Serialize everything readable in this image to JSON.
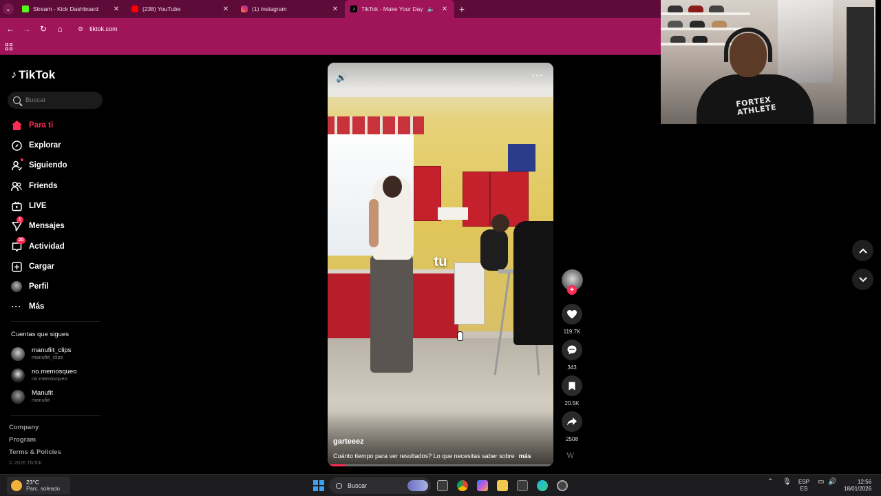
{
  "browser": {
    "tabs": [
      {
        "title": "Stream - Kick Dashboard",
        "favicon_color": "#53fc18"
      },
      {
        "title": "(238) YouTube",
        "favicon_color": "#ff0000"
      },
      {
        "title": "(1) Instagram",
        "favicon_color": "#e1306c"
      },
      {
        "title": "TikTok - Make Your Day",
        "favicon_color": "#000000"
      }
    ],
    "new_tab": "+",
    "url": "tiktok.com",
    "theme_color": "#a0145a"
  },
  "tiktok": {
    "logo": "TikTok",
    "search_placeholder": "Buscar",
    "nav": [
      {
        "label": "Para ti",
        "icon": "home-icon",
        "active": true
      },
      {
        "label": "Explorar",
        "icon": "compass-icon"
      },
      {
        "label": "Siguiendo",
        "icon": "following-icon"
      },
      {
        "label": "Friends",
        "icon": "friends-icon"
      },
      {
        "label": "LIVE",
        "icon": "live-icon"
      },
      {
        "label": "Mensajes",
        "icon": "messages-icon",
        "badge": "1"
      },
      {
        "label": "Actividad",
        "icon": "activity-icon",
        "badge": "20"
      },
      {
        "label": "Cargar",
        "icon": "upload-icon"
      },
      {
        "label": "Perfil",
        "icon": "profile-avatar"
      },
      {
        "label": "Más",
        "icon": "more-icon"
      }
    ],
    "following_title": "Cuentas que sigues",
    "following": [
      {
        "name": "manufiit_clips",
        "handle": "manufiit_clips"
      },
      {
        "name": "no.memosqueo",
        "handle": "no.memosqueo"
      },
      {
        "name": "Manufit",
        "handle": "manufiit"
      }
    ],
    "footer": {
      "company": "Company",
      "program": "Program",
      "terms": "Terms & Policies",
      "copyright": "© 2026 TikTok"
    },
    "accent": "#fe2c55",
    "video": {
      "author": "garteeez",
      "description": "Cuánto tiempo para ver resultados? Lo que necesitas saber sobre",
      "more": "más",
      "overlay_text": "tu",
      "progress": 0.08,
      "likes": "119.7K",
      "comments": "343",
      "saves": "20.5K",
      "shares": "2508"
    }
  },
  "webcam": {
    "shirt_text": "FORTEX\nATHLETE"
  },
  "taskbar": {
    "weather_temp": "23°C",
    "weather_desc": "Parc. soleado",
    "search_label": "Buscar",
    "lang_top": "ESP",
    "lang_bottom": "ES",
    "time": "12:56",
    "date": "18/01/2026"
  }
}
